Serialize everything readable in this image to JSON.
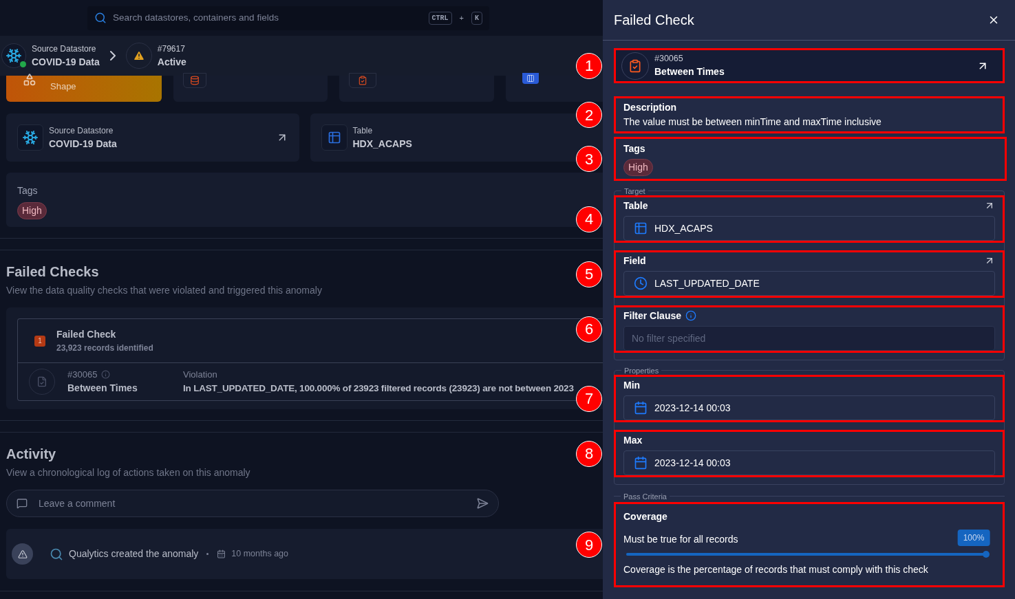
{
  "search": {
    "placeholder": "Search datastores, containers and fields",
    "keys": [
      "CTRL",
      "+",
      "K"
    ]
  },
  "breadcrumb": {
    "datastore": {
      "label": "Source Datastore",
      "name": "COVID-19 Data",
      "online": true
    },
    "anomaly": {
      "id": "#79617",
      "status": "Active"
    }
  },
  "stats": [
    {
      "kind": "shape",
      "label": "Shape"
    },
    {
      "kind": "records"
    },
    {
      "kind": "checks"
    },
    {
      "kind": "fields"
    }
  ],
  "source_cards": [
    {
      "kind": "datastore",
      "label": "Source Datastore",
      "name": "COVID-19 Data",
      "link": true
    },
    {
      "kind": "table",
      "label": "Table",
      "name": "HDX_ACAPS",
      "link": false
    }
  ],
  "tags_card": {
    "title": "Tags",
    "tags": [
      "High"
    ]
  },
  "failed_checks": {
    "title": "Failed Checks",
    "subtitle": "View the data quality checks that were violated and triggered this anomaly",
    "group": {
      "count": "1",
      "expanded": true,
      "title": "Failed Check",
      "subtitle": "23,923 records identified"
    },
    "rows": [
      {
        "id": "#30065",
        "name": "Between Times",
        "violation_label": "Violation",
        "violation": "In LAST_UPDATED_DATE, 100.000% of 23923 filtered records (23923) are not between 2023"
      }
    ]
  },
  "activity": {
    "title": "Activity",
    "subtitle": "View a chronological log of actions taken on this anomaly",
    "comment_placeholder": "Leave a comment",
    "events": [
      {
        "text": "Qualytics created the anomaly",
        "time": "10 months ago"
      }
    ]
  },
  "drawer": {
    "title": "Failed Check",
    "check": {
      "callout": "1",
      "id": "#30065",
      "name": "Between Times"
    },
    "description": {
      "callout": "2",
      "label": "Description",
      "text": "The value must be between minTime and maxTime inclusive"
    },
    "tags": {
      "callout": "3",
      "label": "Tags",
      "items": [
        "High"
      ]
    },
    "groups": [
      {
        "legend": "Target",
        "fields": [
          {
            "callout": "4",
            "label": "Table",
            "kind": "table",
            "value": "HDX_ACAPS",
            "link": true,
            "info": false
          },
          {
            "callout": "5",
            "label": "Field",
            "kind": "time",
            "value": "LAST_UPDATED_DATE",
            "link": true,
            "info": false
          },
          {
            "callout": "6",
            "label": "Filter Clause",
            "kind": "filter",
            "placeholder": "No filter specified",
            "link": false,
            "info": true
          }
        ]
      },
      {
        "legend": "Properties",
        "fields": [
          {
            "callout": "7",
            "label": "Min",
            "kind": "date",
            "value": "2023-12-14 00:03",
            "link": false,
            "info": false
          },
          {
            "callout": "8",
            "label": "Max",
            "kind": "date",
            "value": "2023-12-14 00:03",
            "link": false,
            "info": false
          }
        ]
      }
    ],
    "coverage": {
      "callout": "9",
      "legend": "Pass Criteria",
      "label": "Coverage",
      "caption": "Must be true for all records",
      "reading": "100%",
      "level": 1,
      "help": "Coverage is the percentage of records that must comply with this check"
    }
  }
}
